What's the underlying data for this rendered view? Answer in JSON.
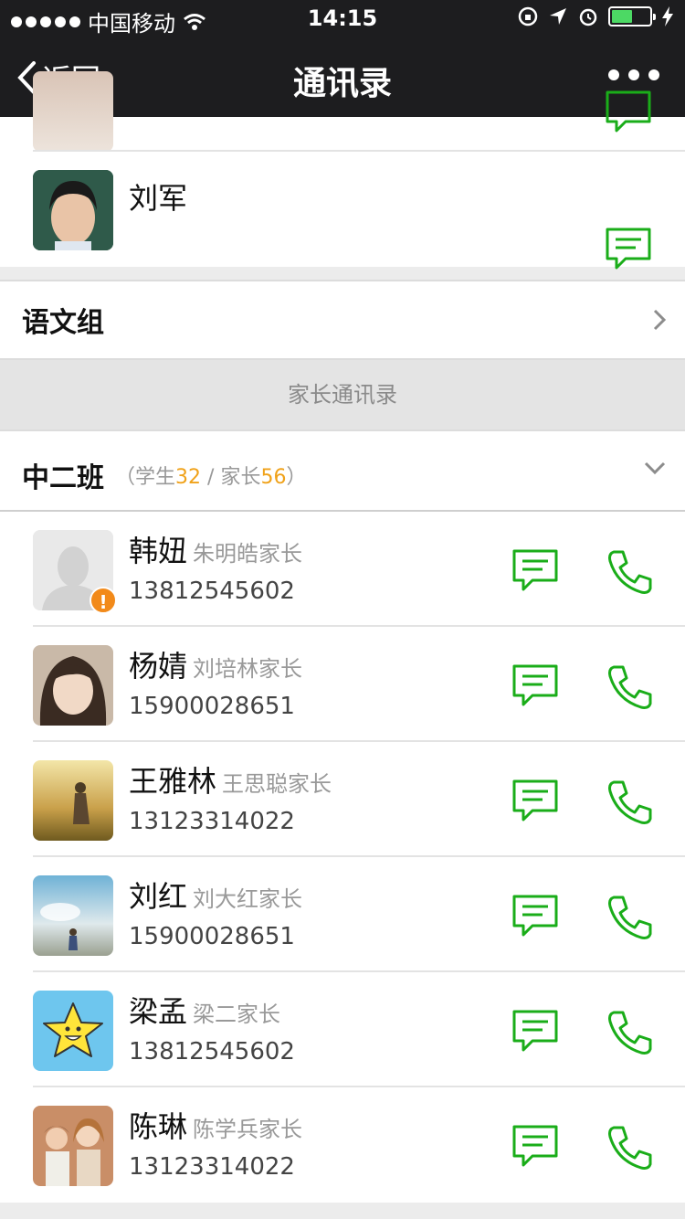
{
  "status_bar": {
    "carrier": "中国移动",
    "time": "14:15"
  },
  "nav": {
    "back_label": "返回",
    "title": "通讯录"
  },
  "teachers": {
    "rows": [
      {
        "name": "刘军"
      }
    ]
  },
  "groups": {
    "chinese_group": "语文组"
  },
  "parent_section": {
    "header": "家长通讯录",
    "class_name": "中二班",
    "students_label": "学生",
    "students_count": "32",
    "parents_label": "家长",
    "parents_count": "56",
    "open": "（",
    "sep": " / ",
    "close": "）"
  },
  "contacts": [
    {
      "name": "韩妞",
      "parent": "朱明皓家长",
      "phone": "13812545602"
    },
    {
      "name": "杨婧",
      "parent": "刘培林家长",
      "phone": "15900028651"
    },
    {
      "name": "王雅林",
      "parent": "王思聪家长",
      "phone": "13123314022"
    },
    {
      "name": "刘红",
      "parent": "刘大红家长",
      "phone": "15900028651"
    },
    {
      "name": "梁孟",
      "parent": "梁二家长",
      "phone": "13812545602"
    },
    {
      "name": "陈琳",
      "parent": "陈学兵家长",
      "phone": "13123314022"
    }
  ],
  "colors": {
    "accent_green": "#1aad19",
    "count_orange": "#f0a21a",
    "nav_bg": "#1d1d1f"
  }
}
